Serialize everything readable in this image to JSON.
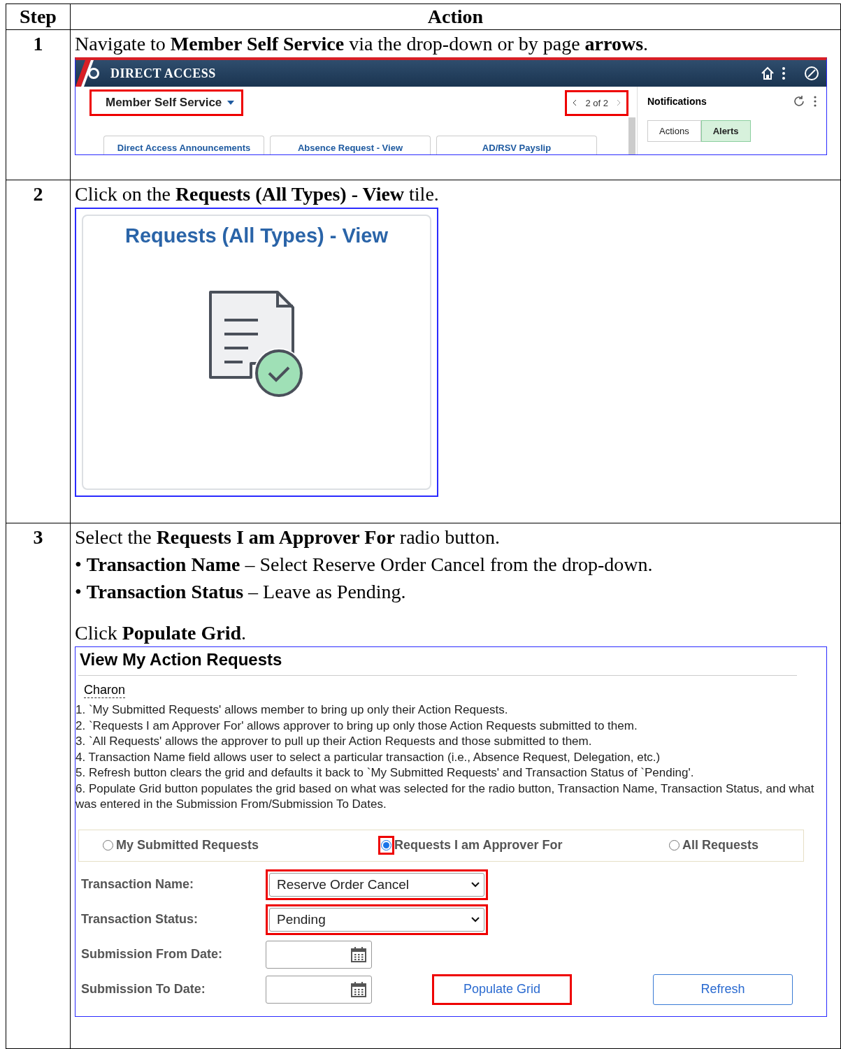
{
  "table": {
    "columns": [
      "Step",
      "Action"
    ],
    "rows": [
      {
        "step": "1",
        "instructions": [
          "Navigate to **Member Self Service** via the drop-down or by page **arrows**."
        ],
        "screenshot": {
          "kind": "homepage",
          "banner_title": "DIRECT ACCESS",
          "homepage_menu": {
            "label": "Member Self Service",
            "highlighted": true
          },
          "pager": {
            "text": "2 of 2",
            "highlighted": true
          },
          "notifications": {
            "title": "Notifications",
            "tabs": [
              {
                "label": "Actions",
                "selected": false
              },
              {
                "label": "Alerts",
                "selected": true
              }
            ]
          },
          "tiles": [
            "Direct Access Announcements",
            "Absence Request - View",
            "AD/RSV Payslip"
          ]
        }
      },
      {
        "step": "2",
        "instructions": [
          "Click on the **Requests (All Types) - View** tile."
        ],
        "screenshot": {
          "kind": "tile",
          "tile_title": "Requests (All Types) - View"
        }
      },
      {
        "step": "3",
        "instructions": [
          "Select the **Requests I am Approver For** radio button.",
          "• **Transaction Name** – Select Reserve Order Cancel from the drop-down.",
          "• **Transaction Status** – Leave as Pending."
        ],
        "closing": "Click **Populate Grid**.",
        "screenshot": {
          "kind": "form",
          "title": "View My Action Requests",
          "user": "Charon",
          "notes": [
            "1. `My Submitted Requests' allows member to bring up only their Action Requests.",
            "2. `Requests I am Approver For' allows approver to bring up only those Action Requests submitted to them.",
            "3. `All Requests' allows the approver to pull up their Action Requests and those submitted to them.",
            "4. Transaction Name field allows user to select a particular transaction (i.e., Absence Request, Delegation, etc.)",
            "5. Refresh button clears the grid and defaults it back to `My Submitted Requests' and Transaction Status of `Pending'.",
            "6. Populate Grid button populates the grid based on what was selected for the radio button, Transaction Name, Transaction Status, and what was entered in the Submission From/Submission To Dates."
          ],
          "radios": [
            {
              "label": "My Submitted Requests",
              "selected": false,
              "highlighted": false
            },
            {
              "label": "Requests I am Approver For",
              "selected": true,
              "highlighted": true
            },
            {
              "label": "All Requests",
              "selected": false,
              "highlighted": false
            }
          ],
          "fields": [
            {
              "label": "Transaction Name:",
              "kind": "select",
              "value": "Reserve Order Cancel",
              "highlighted": true
            },
            {
              "label": "Transaction Status:",
              "kind": "select",
              "value": "Pending",
              "highlighted": true
            },
            {
              "label": "Submission From Date:",
              "kind": "date",
              "highlighted": false
            },
            {
              "label": "Submission To Date:",
              "kind": "date",
              "highlighted": false
            }
          ],
          "buttons": [
            {
              "label": "Populate Grid",
              "highlighted": true
            },
            {
              "label": "Refresh",
              "highlighted": false
            }
          ]
        }
      }
    ]
  }
}
